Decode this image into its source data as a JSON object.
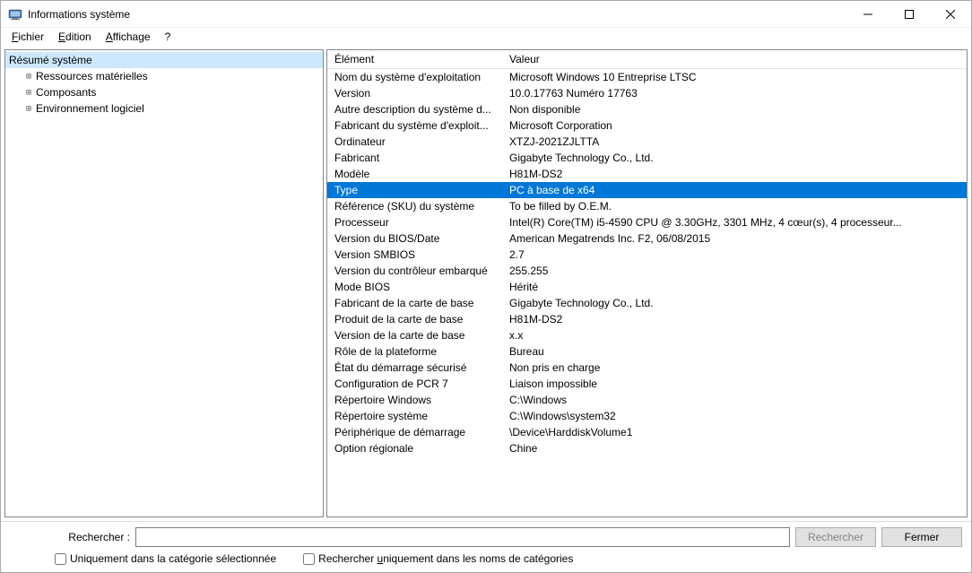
{
  "window": {
    "title": "Informations système"
  },
  "menu": {
    "file": "Fichier",
    "edit": "Edition",
    "view": "Affichage",
    "help": "?"
  },
  "tree": {
    "root": "Résumé système",
    "children": [
      "Ressources matérielles",
      "Composants",
      "Environnement logiciel"
    ]
  },
  "detail": {
    "header_element": "Élément",
    "header_value": "Valeur",
    "rows": [
      {
        "el": "Nom du système d'exploitation",
        "val": "Microsoft Windows 10 Entreprise LTSC"
      },
      {
        "el": "Version",
        "val": "10.0.17763 Numéro 17763"
      },
      {
        "el": "Autre description du système d...",
        "val": "Non disponible"
      },
      {
        "el": "Fabricant du système d'exploit...",
        "val": "Microsoft Corporation"
      },
      {
        "el": "Ordinateur",
        "val": "XTZJ-2021ZJLTTA"
      },
      {
        "el": "Fabricant",
        "val": "Gigabyte Technology Co., Ltd."
      },
      {
        "el": "Modèle",
        "val": "H81M-DS2"
      },
      {
        "el": "Type",
        "val": "PC à base de x64",
        "selected": true
      },
      {
        "el": "Référence (SKU) du système",
        "val": "To be filled by O.E.M."
      },
      {
        "el": "Processeur",
        "val": "Intel(R) Core(TM) i5-4590 CPU @ 3.30GHz, 3301 MHz, 4 cœur(s), 4 processeur..."
      },
      {
        "el": "Version du BIOS/Date",
        "val": "American Megatrends Inc. F2, 06/08/2015"
      },
      {
        "el": "Version SMBIOS",
        "val": "2.7"
      },
      {
        "el": "Version du contrôleur embarqué",
        "val": "255.255"
      },
      {
        "el": "Mode BIOS",
        "val": "Hérité"
      },
      {
        "el": "Fabricant de la carte de base",
        "val": "Gigabyte Technology Co., Ltd."
      },
      {
        "el": "Produit de la carte de base",
        "val": "H81M-DS2"
      },
      {
        "el": "Version de la carte de base",
        "val": "x.x"
      },
      {
        "el": "Rôle de la plateforme",
        "val": "Bureau"
      },
      {
        "el": "État du démarrage sécurisé",
        "val": "Non pris en charge"
      },
      {
        "el": "Configuration de PCR 7",
        "val": "Liaison impossible"
      },
      {
        "el": "Répertoire Windows",
        "val": "C:\\Windows"
      },
      {
        "el": "Répertoire système",
        "val": "C:\\Windows\\system32"
      },
      {
        "el": "Périphérique de démarrage",
        "val": "\\Device\\HarddiskVolume1"
      },
      {
        "el": "Option régionale",
        "val": "Chine"
      }
    ]
  },
  "footer": {
    "search_label": "Rechercher :",
    "search_btn": "Rechercher",
    "close_btn": "Fermer",
    "check_selected": "Uniquement dans la catégorie sélectionnée",
    "check_names": "Rechercher uniquement dans les noms de catégories"
  }
}
